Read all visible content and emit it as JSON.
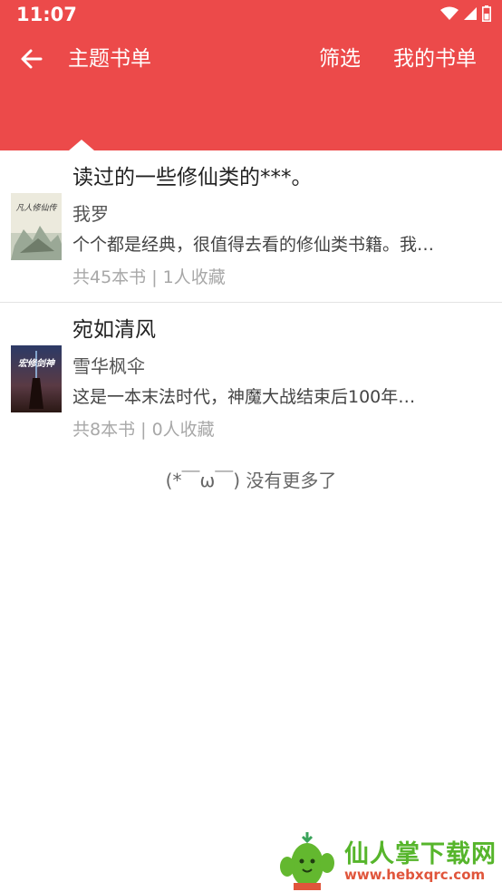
{
  "status": {
    "time": "11:07",
    "icons": [
      "wifi-icon",
      "signal-icon",
      "battery-icon"
    ]
  },
  "header": {
    "title": "主题书单",
    "filter_label": "筛选",
    "my_booklist_label": "我的书单",
    "accent": "#ec4a4a"
  },
  "booklists": [
    {
      "title": "读过的一些修仙类的***。",
      "author": "我罗",
      "description": "个个都是经典，很值得去看的修仙类书籍。我…",
      "book_count": "共45本书 |",
      "favorites": "1人收藏",
      "cover_text": "凡人修仙传"
    },
    {
      "title": "宛如清风",
      "author": "雪华枫伞",
      "description": "这是一本末法时代，神魔大战结束后100年…",
      "book_count": "共8本书 |",
      "favorites": "0人收藏",
      "cover_text": "宏修剑神"
    }
  ],
  "end_message": "(*￣ω￣) 没有更多了",
  "watermark": {
    "title": "仙人掌下载网",
    "url": "www.hebxqrc.com"
  }
}
